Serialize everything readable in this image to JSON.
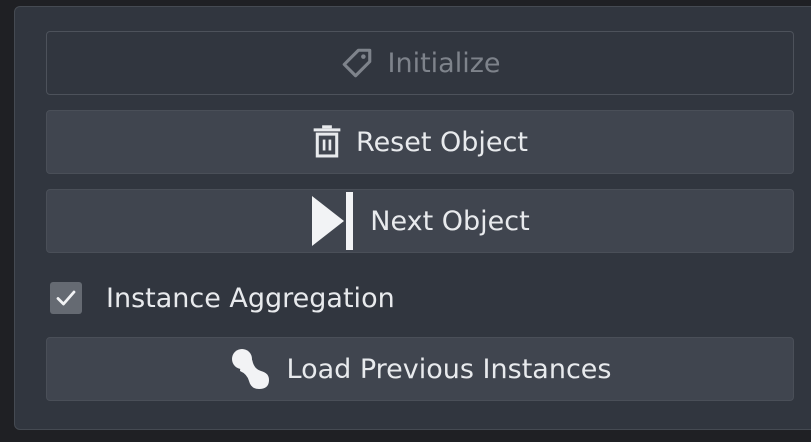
{
  "panel": {
    "buttons": {
      "initialize": {
        "label": "Initialize",
        "icon": "tag-icon",
        "enabled": false
      },
      "reset": {
        "label": "Reset Object",
        "icon": "trash-icon",
        "enabled": true
      },
      "next": {
        "label": "Next Object",
        "icon": "skip-next-icon",
        "enabled": true
      },
      "load": {
        "label": "Load Previous Instances",
        "icon": "blob-icon",
        "enabled": true
      }
    },
    "aggregation": {
      "label": "Instance Aggregation",
      "checked": true
    }
  },
  "colors": {
    "panel_bg": "#31363f",
    "button_bg": "#40454f",
    "text": "#e8eaed",
    "disabled_text": "#7e838b",
    "checkbox_bg": "#656a72"
  }
}
